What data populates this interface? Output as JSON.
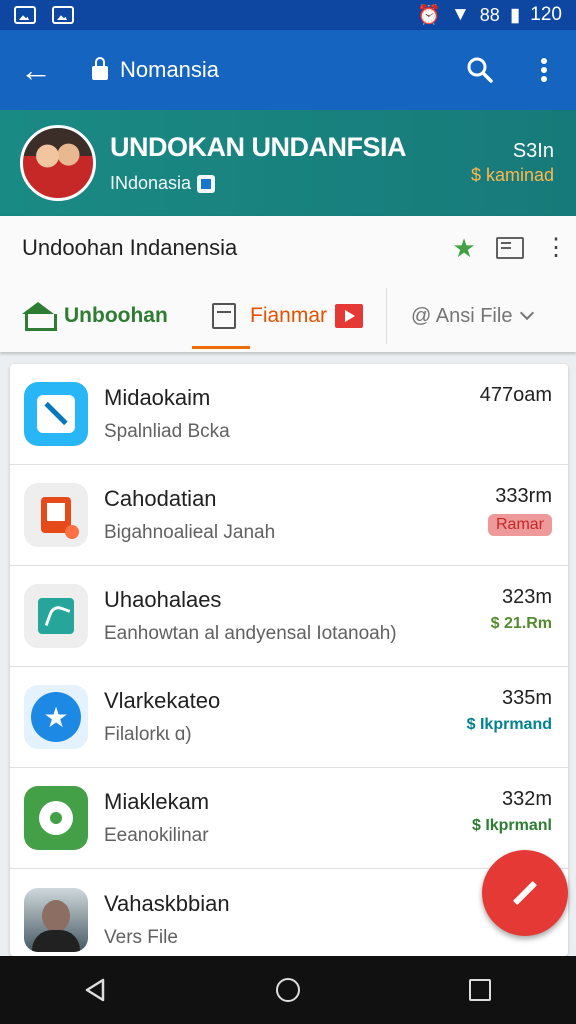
{
  "status_bar": {
    "signal_text": "88",
    "time": "120"
  },
  "app_bar": {
    "title": "Nomansia"
  },
  "profile": {
    "title": "UNDOKAN UNDANFSIA",
    "subtitle": "INdonasia",
    "right_top": "S3In",
    "right_bottom": "$ kaminad"
  },
  "subheader": {
    "title": "Undoohan Indanensia"
  },
  "tabs": [
    {
      "label": "Unboohan"
    },
    {
      "label": "Fianmar"
    },
    {
      "label": "@ Ansi File"
    }
  ],
  "list": [
    {
      "title": "Midaokaim",
      "subtitle": "Spalnliad Bcka",
      "time": "477oam",
      "tag": ""
    },
    {
      "title": "Cahodatian",
      "subtitle": "Bigahnoalieal Janah",
      "time": "333rm",
      "tag": "Ramar"
    },
    {
      "title": "Uhaohalaes",
      "subtitle": "Eanhowtan al andyensal Iotanoah)",
      "time": "323m",
      "tag": "$ 21.Rm"
    },
    {
      "title": "Vlarkekateo",
      "subtitle": "Filalorkɩ ɑ)",
      "time": "335m",
      "tag": "$ Ikprmand"
    },
    {
      "title": "Miaklekam",
      "subtitle": "Eeanokilinar",
      "time": "332m",
      "tag": "$ Ikprmanl"
    },
    {
      "title": "Vahaskbbian",
      "subtitle": "Vers File",
      "time": "",
      "tag": ""
    }
  ],
  "colors": {
    "status_bar": "#0d47a1",
    "app_bar": "#1565c0",
    "profile_bg": "#1a8a84",
    "accent_green": "#2e7d32",
    "accent_orange": "#e65100",
    "fab": "#e53935"
  }
}
